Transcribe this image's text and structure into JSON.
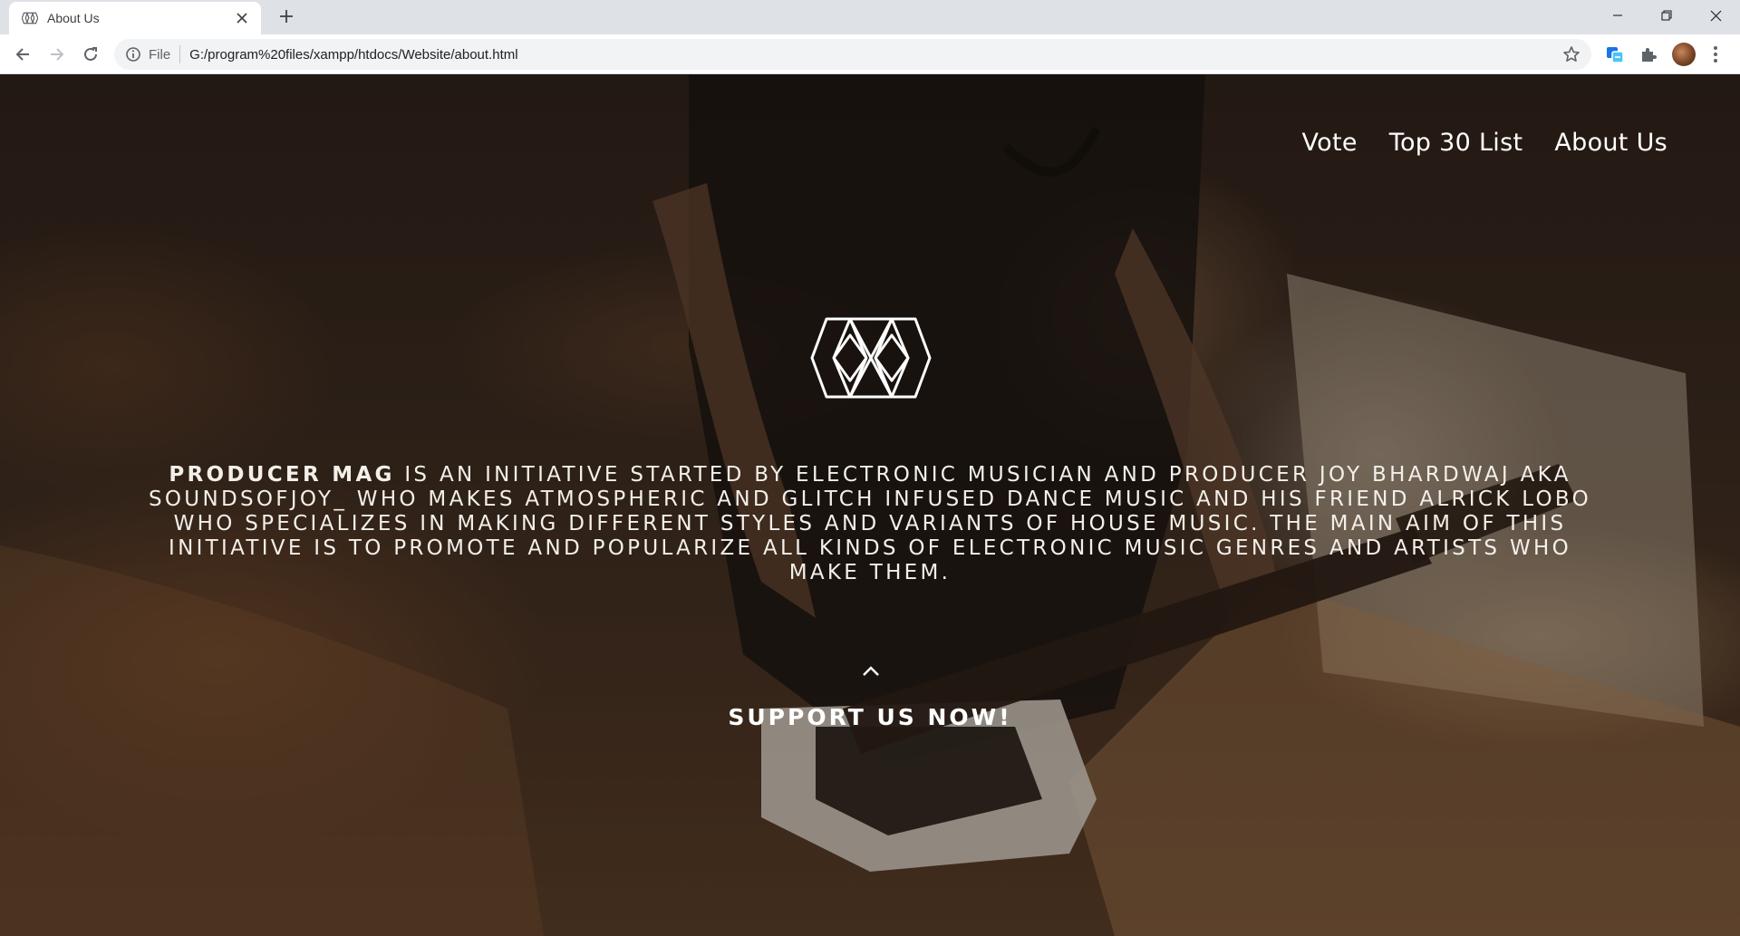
{
  "browser": {
    "tab": {
      "title": "About Us",
      "favicon": "producer-mag-logo-icon"
    },
    "new_tab_icon": "plus-icon",
    "window_controls": [
      "minimize-icon",
      "restore-icon",
      "close-icon"
    ],
    "omnibox": {
      "scheme_label": "File",
      "url": "G:/program%20files/xampp/htdocs/Website/about.html"
    },
    "toolbar_icons": [
      "bookmark-star-icon",
      "translate-icon",
      "extensions-puzzle-icon",
      "profile-avatar",
      "menu-dots-icon"
    ]
  },
  "page": {
    "nav": [
      {
        "label": "Vote"
      },
      {
        "label": "Top 30 List"
      },
      {
        "label": "About Us"
      }
    ],
    "about": {
      "brand": "Producer Mag",
      "text": " is an initiative started by electronic musician and producer Joy Bhardwaj aka soundsofjoy_ who makes atmospheric and glitch infused dance music and his friend Alrick Lobo who specializes in making different styles and variants of house music. The main aim of this initiative is to promote and popularize all kinds of electronic music genres and artists who make them."
    },
    "support_label": "SUPPORT US NOW!",
    "colors": {
      "text": "#ffffff",
      "tab_bar": "#dee1e6",
      "omnibox": "#f1f3f4"
    }
  }
}
